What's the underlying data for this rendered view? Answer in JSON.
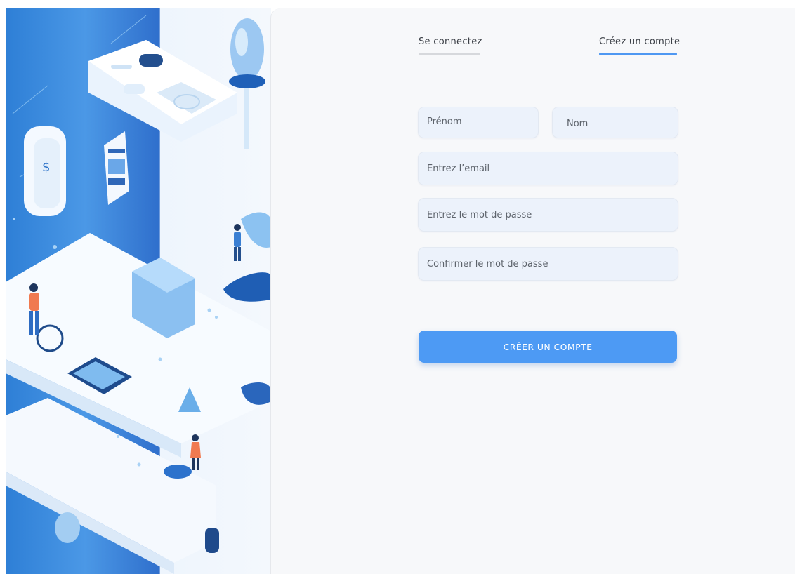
{
  "tabs": {
    "login_label": "Se connectez",
    "signup_label": "Créez un compte",
    "active": "signup"
  },
  "form": {
    "first_name_placeholder": "Prénom",
    "last_name_placeholder": "Nom",
    "email_placeholder": "Entrez l’email",
    "password_placeholder": "Entrez le mot de passe",
    "confirm_password_placeholder": "Confirmer le mot de passe",
    "submit_label": "CRÉER UN COMPTE"
  },
  "colors": {
    "accent": "#4d9af4",
    "field_background": "#ecf2fb",
    "panel_background": "#f7f8fa"
  }
}
